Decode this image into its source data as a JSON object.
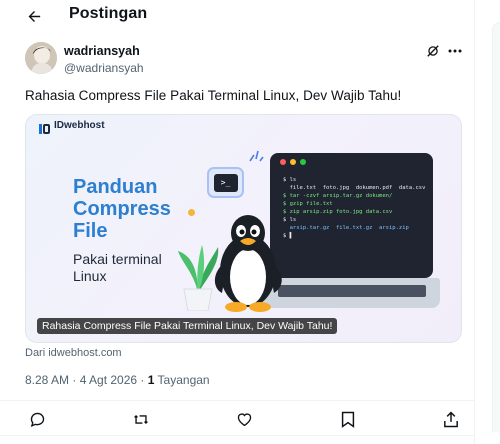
{
  "header": {
    "title": "Postingan"
  },
  "author": {
    "name": "wadriansyah",
    "handle": "@wadriansyah"
  },
  "post": {
    "text": "Rahasia Compress File Pakai Terminal Linux, Dev Wajib Tahu!"
  },
  "card": {
    "logo_text": "IDwebhost",
    "title_lines": [
      "Panduan",
      "Compress",
      "File"
    ],
    "subtitle_lines": [
      "Pakai terminal",
      "Linux"
    ],
    "terminal_lines": [
      "$ ls",
      "  file.txt  foto.jpg  dokumen.pdf  data.csv",
      "$ tar -czvf arsip.tar.gz dokumen/",
      "$ gzip file.txt",
      "$ zip arsip.zip foto.jpg data.csv",
      "$ ls",
      "  arsip.tar.gz  file.txt.gz  arsip.zip",
      "$ ▌"
    ],
    "caption": "Rahasia Compress File Pakai Terminal Linux, Dev Wajib Tahu!",
    "colors": {
      "title": "#2d7fd0",
      "terminal": "#1f2430"
    }
  },
  "source": "Dari idwebhost.com",
  "meta": {
    "time_date": "8.28 AM · 4 Agt 2026 · ",
    "views_count": "1",
    "views_label": " Tayangan"
  },
  "icons": {
    "back": "arrow-left-icon",
    "grok": "grok-icon",
    "more": "more-icon",
    "reply": "reply-icon",
    "repost": "repost-icon",
    "like": "like-icon",
    "bookmark": "bookmark-icon",
    "share": "share-icon"
  },
  "colors": {
    "text": "#0f1419",
    "secondary": "#536471",
    "border": "#eff3f4"
  }
}
